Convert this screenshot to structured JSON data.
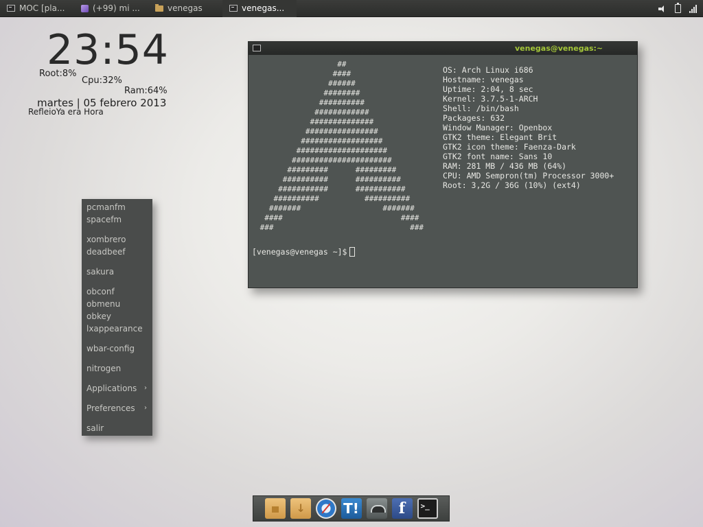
{
  "taskbar": {
    "tasks": [
      {
        "label": "MOC [pla...",
        "icon": "terminal-icon"
      },
      {
        "label": "(+99) mi ...",
        "icon": "feather-icon"
      },
      {
        "label": "venegas",
        "icon": "folder-icon"
      },
      {
        "label": "venegas...",
        "icon": "terminal-icon"
      }
    ],
    "tray": [
      "volume-icon",
      "battery-icon",
      "network-signal-icon"
    ]
  },
  "conky": {
    "time": "23:54",
    "root": "Root:8%",
    "cpu": "Cpu:32%",
    "ram": "Ram:64%",
    "date": "martes | 05 febrero 2013",
    "note": "RefleioYa era Hora"
  },
  "terminal": {
    "title": "venegas@venegas:~",
    "ascii_art": [
      "                  ##",
      "                 ####",
      "                ######",
      "               ########",
      "              ##########",
      "             ############",
      "            ##############",
      "           ################",
      "          ##################",
      "         ####################",
      "        ######################",
      "       #########      #########",
      "      ##########      ##########",
      "     ###########      ###########",
      "    ##########          ##########",
      "   #######                  #######",
      "  ####                          ####",
      " ###                              ###"
    ],
    "sysinfo": [
      "OS: Arch Linux i686",
      "Hostname: venegas",
      "Uptime: 2:04, 8 sec",
      "Kernel: 3.7.5-1-ARCH",
      "Shell: /bin/bash",
      "Packages: 632",
      "Window Manager: Openbox",
      "GTK2 theme: Elegant Brit",
      "GTK2 icon theme: Faenza-Dark",
      "GTK2 font name: Sans 10",
      "RAM: 281 MB / 436 MB (64%)",
      "CPU: AMD Sempron(tm) Processor 3000+",
      "Root: 3,2G / 36G (10%) (ext4)"
    ],
    "prompt": "[venegas@venegas ~]$"
  },
  "menu": {
    "groups": [
      [
        {
          "label": "pcmanfm"
        },
        {
          "label": "spacefm"
        }
      ],
      [
        {
          "label": "xombrero"
        },
        {
          "label": "deadbeef"
        }
      ],
      [
        {
          "label": "sakura"
        }
      ],
      [
        {
          "label": "obconf"
        },
        {
          "label": "obmenu"
        },
        {
          "label": "obkey"
        },
        {
          "label": "lxappearance"
        }
      ],
      [
        {
          "label": "wbar-config"
        }
      ],
      [
        {
          "label": "nitrogen"
        }
      ],
      [
        {
          "label": "Applications",
          "submenu": true
        }
      ],
      [
        {
          "label": "Preferences",
          "submenu": true
        }
      ],
      [
        {
          "label": "salir"
        }
      ]
    ],
    "submenu_arrow": "›"
  },
  "dock": {
    "items": [
      {
        "name": "home-folder-icon",
        "glyph": ""
      },
      {
        "name": "downloads-folder-icon",
        "glyph": ""
      },
      {
        "name": "safari-compass-icon",
        "glyph": ""
      },
      {
        "name": "tumblr-icon",
        "glyph": "T!"
      },
      {
        "name": "gnome-foot-icon",
        "glyph": ""
      },
      {
        "name": "facebook-icon",
        "glyph": "f"
      },
      {
        "name": "terminal-icon",
        "glyph": ">_"
      }
    ]
  },
  "colors": {
    "terminal_title": "#a4c639",
    "terminal_bg": "#4f5452",
    "menu_bg": "#4a4c4b",
    "panel_bg": "#2c2d2b"
  }
}
